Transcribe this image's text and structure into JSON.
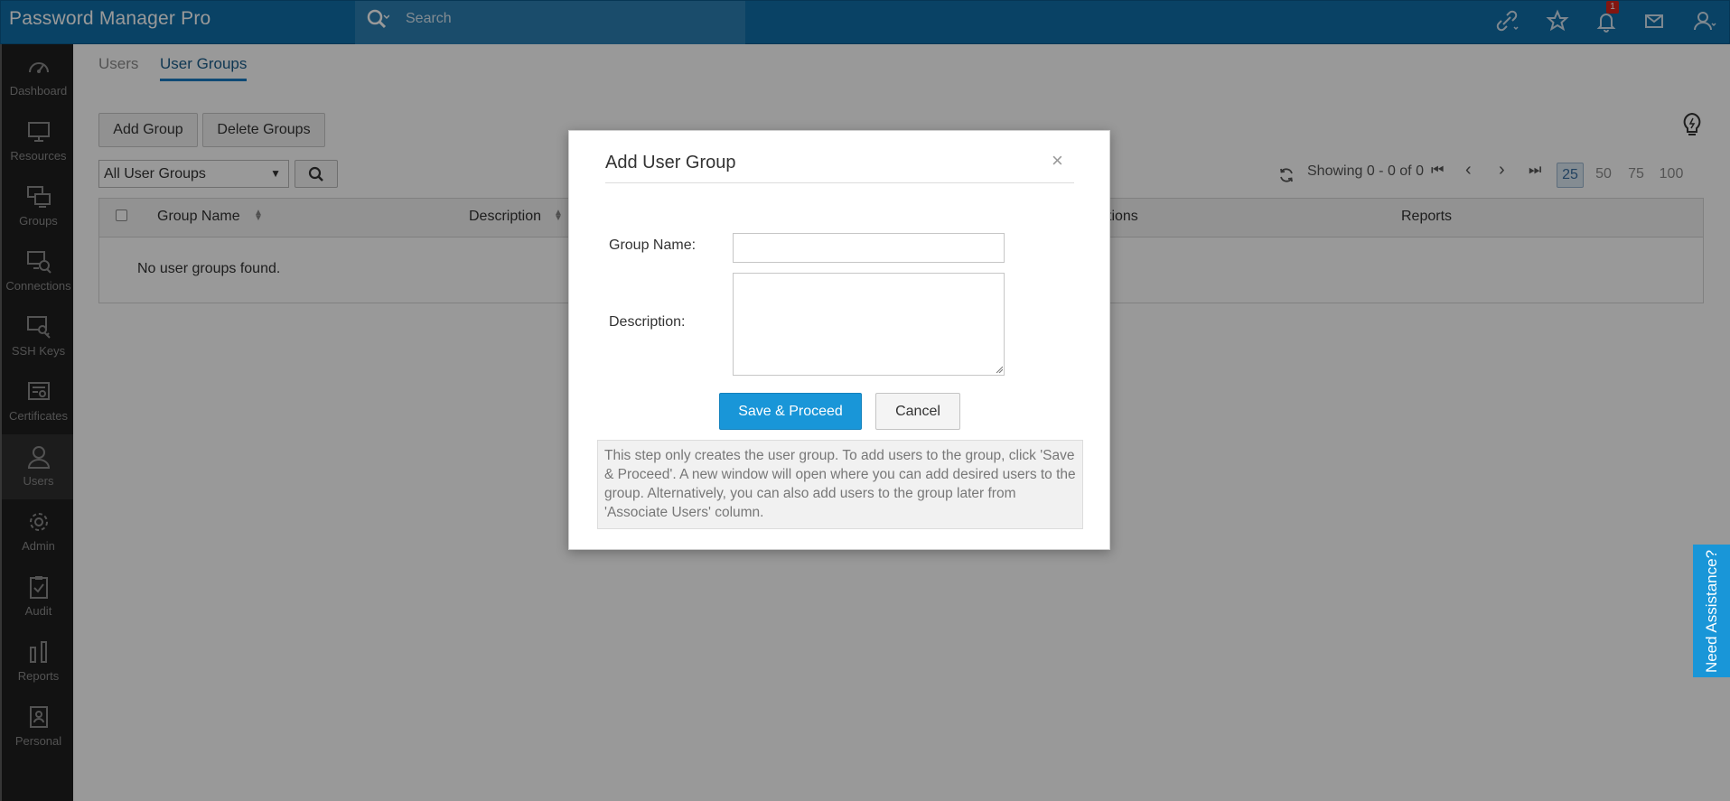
{
  "app": {
    "logo_main": "Password Manager Pro",
    "search_placeholder": "Search",
    "notification_count": "1"
  },
  "sidebar": {
    "items": [
      {
        "label": "Dashboard",
        "icon": "dashboard-icon"
      },
      {
        "label": "Resources",
        "icon": "monitor-icon"
      },
      {
        "label": "Groups",
        "icon": "groups-icon"
      },
      {
        "label": "Connections",
        "icon": "connections-icon"
      },
      {
        "label": "SSH Keys",
        "icon": "ssh-keys-icon"
      },
      {
        "label": "Certificates",
        "icon": "certificates-icon"
      },
      {
        "label": "Users",
        "icon": "user-icon"
      },
      {
        "label": "Admin",
        "icon": "gear-icon"
      },
      {
        "label": "Audit",
        "icon": "clipboard-check-icon"
      },
      {
        "label": "Reports",
        "icon": "bar-chart-icon"
      },
      {
        "label": "Personal",
        "icon": "contact-card-icon"
      }
    ],
    "active": "Users"
  },
  "tabs": [
    {
      "label": "Users"
    },
    {
      "label": "User Groups"
    }
  ],
  "toolbar": {
    "add_group": "Add Group",
    "delete_groups": "Delete Groups",
    "filter_selected": "All User Groups",
    "showing": "Showing 0 - 0 of 0",
    "page_sizes": [
      "25",
      "50",
      "75",
      "100"
    ],
    "selected_page_size": "25"
  },
  "table": {
    "columns": [
      "Group Name",
      "Description",
      "tions",
      "Reports"
    ],
    "empty_message": "No user groups found."
  },
  "help_tab": "Need Assistance?",
  "modal": {
    "title": "Add User Group",
    "close": "×",
    "group_name_label": "Group Name:",
    "group_name_value": "",
    "description_label": "Description:",
    "description_value": "",
    "save_label": "Save & Proceed",
    "cancel_label": "Cancel",
    "note": "This step only creates the user group. To add users to the group, click 'Save & Proceed'. A new window will open where you can add desired users to the group. Alternatively, you can also add users to the group later from 'Associate Users' column."
  },
  "colors": {
    "topbar": "#0f6ea8",
    "sidebar": "#1e1e1e",
    "accent": "#1996d8",
    "badge": "#d9261c"
  }
}
